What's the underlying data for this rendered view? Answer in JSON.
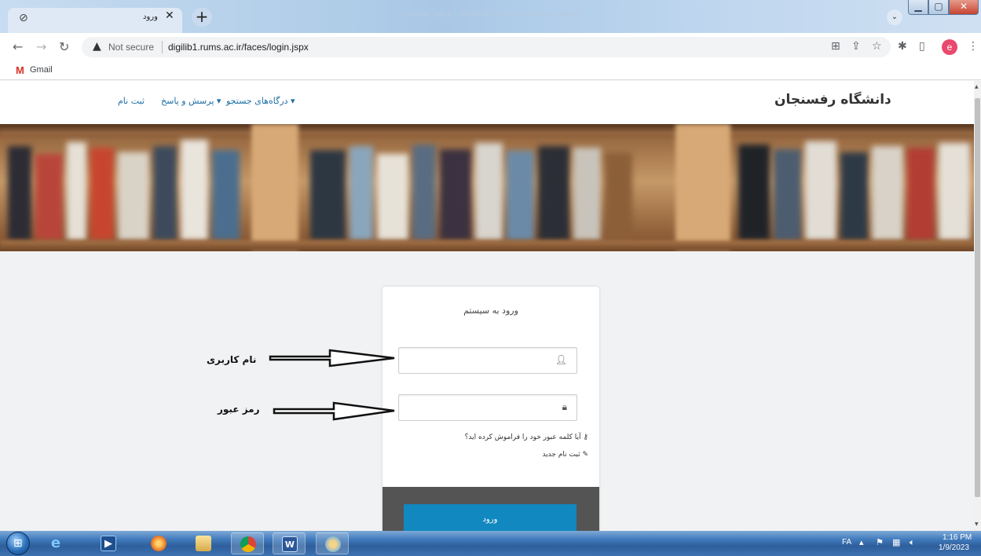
{
  "browser": {
    "tab_title": "ورود",
    "ghost_title": "D. user_lab.e - Word (Product Activation Failed)",
    "url_security": "Not secure",
    "url": "digilib1.rums.ac.ir/faces/login.jspx",
    "bookmark_gmail": "Gmail",
    "profile_initial": "e"
  },
  "site": {
    "brand": "دانشگاه رفسنجان",
    "nav": {
      "search_portals": "درگاه‌های جستجو ▾",
      "qa": "پرسش و پاسخ ▾",
      "register": "ثبت نام"
    }
  },
  "login": {
    "title": "ورود به سیستم",
    "forgot_password": "آیا کلمه عبور خود را فراموش کرده اید؟",
    "new_signup": "ثبت نام جدید",
    "submit": "ورود"
  },
  "annotations": {
    "username_label": "نام کاربری",
    "password_label": "رمز عبور"
  },
  "taskbar": {
    "language": "FA",
    "time": "1:16 PM",
    "date": "1/9/2023"
  }
}
